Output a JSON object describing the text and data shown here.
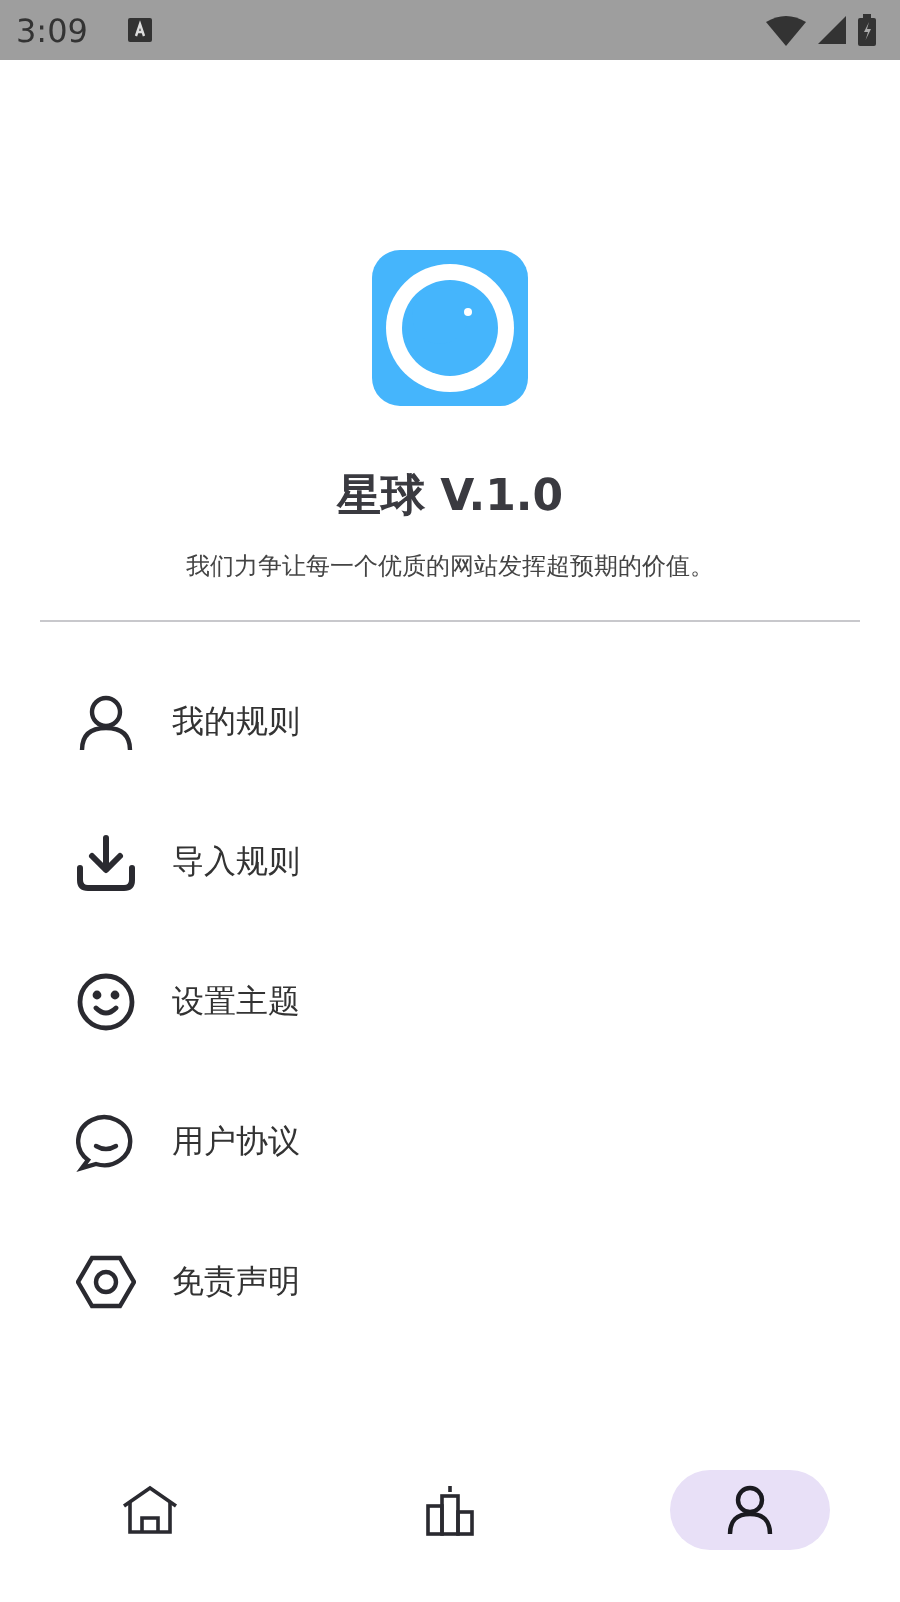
{
  "status_bar": {
    "time": "3:09"
  },
  "app": {
    "title": "星球 V.1.0",
    "tagline": "我们力争让每一个优质的网站发挥超预期的价值。"
  },
  "menu": [
    {
      "kind": "user",
      "label": "我的规则"
    },
    {
      "kind": "download",
      "label": "导入规则"
    },
    {
      "kind": "smile",
      "label": "设置主题"
    },
    {
      "kind": "chat",
      "label": "用户协议"
    },
    {
      "kind": "nut",
      "label": "免责声明"
    }
  ],
  "nav": [
    {
      "kind": "home",
      "selected": false
    },
    {
      "kind": "podium",
      "selected": false
    },
    {
      "kind": "user",
      "selected": true
    }
  ]
}
